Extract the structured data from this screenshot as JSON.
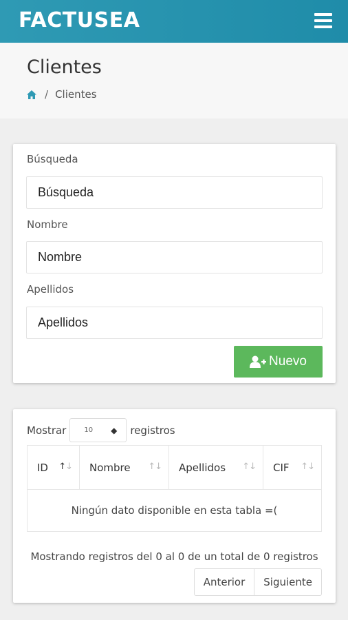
{
  "app": {
    "brand": "FACTUSEA"
  },
  "header": {
    "title": "Clientes",
    "breadcrumb": {
      "separator": "/",
      "current": "Clientes"
    }
  },
  "filters": {
    "search": {
      "label": "Búsqueda",
      "placeholder": "Búsqueda"
    },
    "name": {
      "label": "Nombre",
      "placeholder": "Nombre"
    },
    "surname": {
      "label": "Apellidos",
      "placeholder": "Apellidos"
    },
    "new_button": "Nuevo"
  },
  "table": {
    "show_prefix": "Mostrar",
    "page_length": "10",
    "show_suffix": "registros",
    "columns": [
      "ID",
      "Nombre",
      "Apellidos",
      "CIF"
    ],
    "empty_message": "Ningún dato disponible en esta tabla =(",
    "info": "Mostrando registros del 0 al 0 de un total de 0 registros",
    "prev": "Anterior",
    "next": "Siguiente"
  },
  "colors": {
    "topbar": "#2f9ab4",
    "success": "#5cb85c",
    "link": "#2f9ab4"
  }
}
